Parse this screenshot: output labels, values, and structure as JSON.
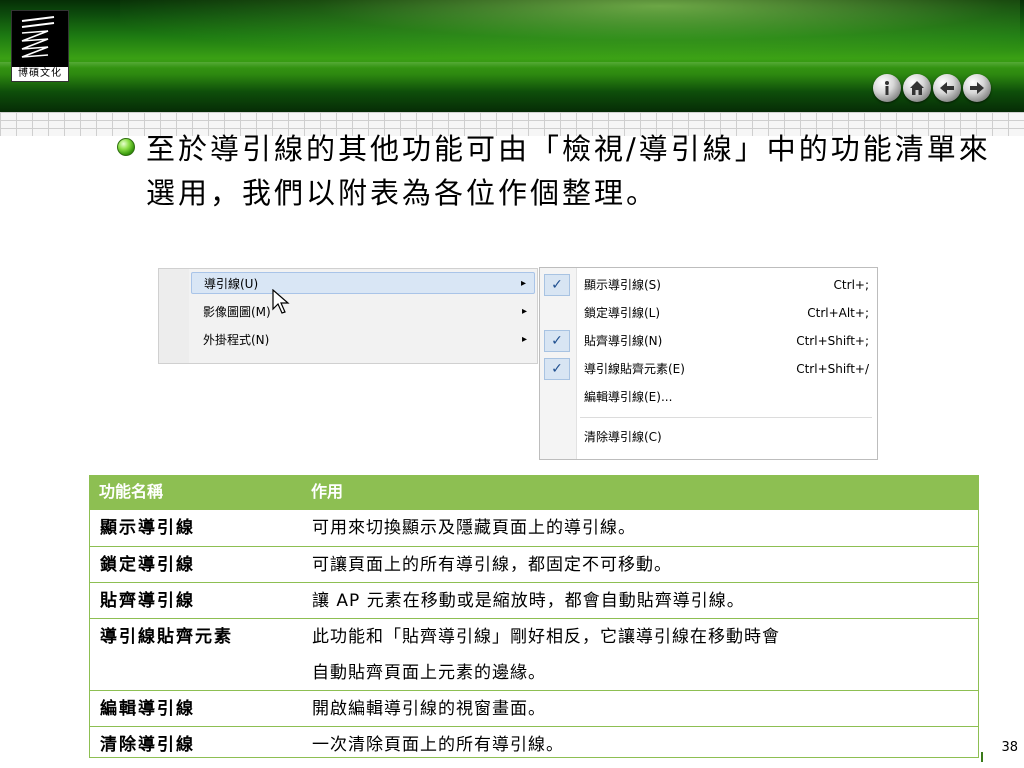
{
  "logo": {
    "text": "博碩文化",
    "icon": "layered-stack-logo"
  },
  "nav_buttons": [
    {
      "name": "info",
      "icon": "info-icon"
    },
    {
      "name": "home",
      "icon": "home-icon"
    },
    {
      "name": "back",
      "icon": "arrow-left-icon"
    },
    {
      "name": "forward",
      "icon": "arrow-right-icon"
    }
  ],
  "body": {
    "bullet_icon": "green-orb-bullet-icon",
    "text": "至於導引線的其他功能可由「檢視/導引線」中的功能清單來選用，我們以附表為各位作個整理。"
  },
  "menu": {
    "items": [
      {
        "label": "導引線(U)",
        "arrow": "▸",
        "highlighted": true
      },
      {
        "label": "影像圖圖(M)",
        "arrow": "▸",
        "highlighted": false
      },
      {
        "label": "外掛程式(N)",
        "arrow": "▸",
        "highlighted": false
      }
    ]
  },
  "submenu": {
    "items": [
      {
        "label": "顯示導引線(S)",
        "shortcut": "Ctrl+;",
        "checked": true
      },
      {
        "label": "鎖定導引線(L)",
        "shortcut": "Ctrl+Alt+;",
        "checked": false
      },
      {
        "label": "貼齊導引線(N)",
        "shortcut": "Ctrl+Shift+;",
        "checked": true
      },
      {
        "label": "導引線貼齊元素(E)",
        "shortcut": "Ctrl+Shift+/",
        "checked": true
      },
      {
        "label": "編輯導引線(E)...",
        "shortcut": "",
        "checked": false
      },
      {
        "label": "清除導引線(C)",
        "shortcut": "",
        "checked": false
      }
    ],
    "check_mark": "✓"
  },
  "table": {
    "headers": [
      "功能名稱",
      "作用"
    ],
    "rows": [
      {
        "name": "顯示導引線",
        "desc": [
          "可用來切換顯示及隱藏頁面上的導引線。"
        ]
      },
      {
        "name": "鎖定導引線",
        "desc": [
          "可讓頁面上的所有導引線，都固定不可移動。"
        ]
      },
      {
        "name": "貼齊導引線",
        "desc": [
          "讓 AP 元素在移動或是縮放時，都會自動貼齊導引線。"
        ]
      },
      {
        "name": "導引線貼齊元素",
        "desc": [
          "此功能和「貼齊導引線」剛好相反，它讓導引線在移動時會",
          "自動貼齊頁面上元素的邊緣。"
        ]
      },
      {
        "name": "編輯導引線",
        "desc": [
          "開啟編輯導引線的視窗畫面。"
        ]
      },
      {
        "name": "清除導引線",
        "desc": [
          "一次清除頁面上的所有導引線。"
        ]
      }
    ],
    "colors": {
      "header_bg": "#8dbf52",
      "border": "#8dbf52"
    }
  },
  "page_number": "38",
  "theme": {
    "header_green": "#1d7a12",
    "accent_green": "#8dbf52"
  }
}
